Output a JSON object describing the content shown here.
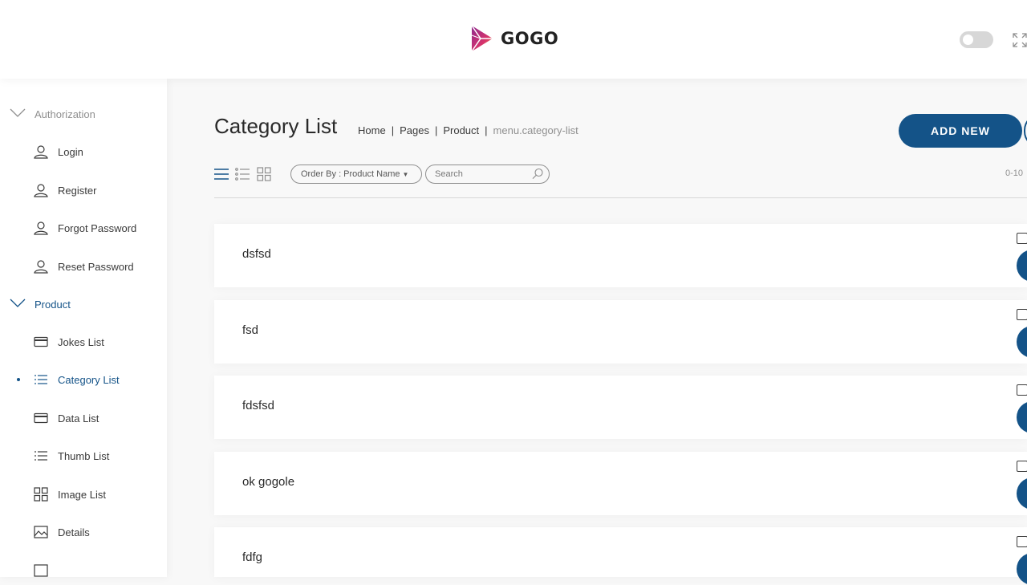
{
  "brand": {
    "name": "GOGO"
  },
  "sidebar": {
    "groups": [
      {
        "label": "Authorization",
        "items": [
          {
            "label": "Login",
            "icon": "user-icon"
          },
          {
            "label": "Register",
            "icon": "user-icon"
          },
          {
            "label": "Forgot Password",
            "icon": "user-icon"
          },
          {
            "label": "Reset Password",
            "icon": "user-icon"
          }
        ]
      },
      {
        "label": "Product",
        "items": [
          {
            "label": "Jokes List",
            "icon": "credit-card-icon"
          },
          {
            "label": "Category List",
            "icon": "list-icon",
            "active": true
          },
          {
            "label": "Data List",
            "icon": "credit-card-icon"
          },
          {
            "label": "Thumb List",
            "icon": "list-icon"
          },
          {
            "label": "Image List",
            "icon": "grid-icon"
          },
          {
            "label": "Details",
            "icon": "image-icon"
          }
        ]
      }
    ]
  },
  "page": {
    "title": "Category List",
    "breadcrumb": [
      "Home",
      "Pages",
      "Product",
      "menu.category-list"
    ],
    "add_button": "ADD NEW",
    "order_by": "Order By : Product Name",
    "search_placeholder": "Search",
    "count_text": "0-10"
  },
  "categories": [
    {
      "name": "dsfsd"
    },
    {
      "name": "fsd"
    },
    {
      "name": "fdsfsd"
    },
    {
      "name": "ok gogole"
    },
    {
      "name": "fdfg"
    }
  ],
  "colors": {
    "primary": "#145388",
    "background": "#f8f8f8",
    "muted_text": "#8f8f8f"
  }
}
